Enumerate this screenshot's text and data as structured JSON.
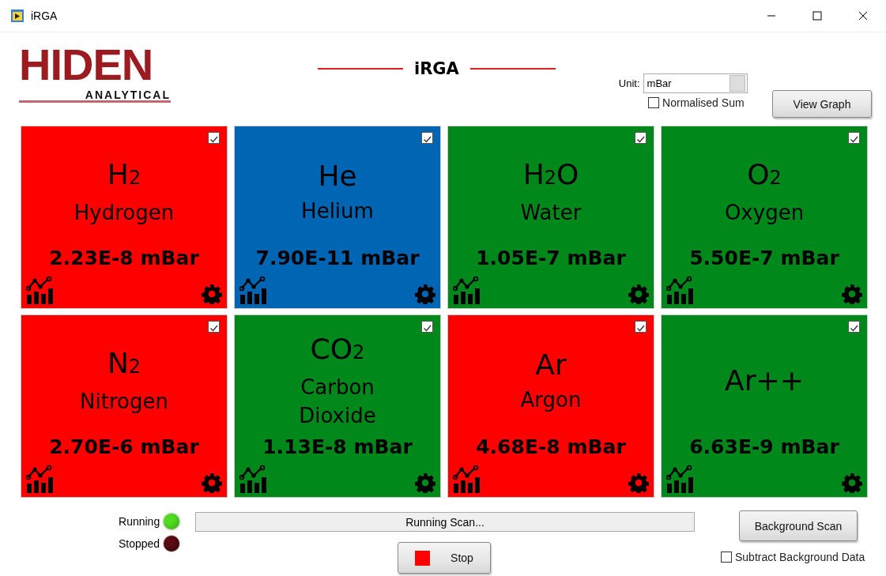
{
  "window": {
    "title": "iRGA"
  },
  "logo": {
    "name": "HIDEN",
    "tagline": "ANALYTICAL"
  },
  "header": {
    "title": "iRGA"
  },
  "unit": {
    "label": "Unit:",
    "value": "mBar"
  },
  "normalised_sum": {
    "label": "Normalised Sum",
    "checked": false
  },
  "view_graph_button": "View Graph",
  "gases": [
    {
      "formula": "H$_{2}$",
      "name": "Hydrogen",
      "reading": "2.23E-8 mBar",
      "color": "#ff0000",
      "checked": true
    },
    {
      "formula": "He",
      "name": "Helium",
      "reading": "7.90E-11 mBar",
      "color": "#0066b3",
      "checked": true
    },
    {
      "formula": "H$_{2}$O",
      "name": "Water",
      "reading": "1.05E-7 mBar",
      "color": "#00891a",
      "checked": true
    },
    {
      "formula": "O$_{2}$",
      "name": "Oxygen",
      "reading": "5.50E-7 mBar",
      "color": "#00891a",
      "checked": true
    },
    {
      "formula": "N$_{2}$",
      "name": "Nitrogen",
      "reading": "2.70E-6 mBar",
      "color": "#ff0000",
      "checked": true
    },
    {
      "formula": "CO$_{2}$",
      "name": "Carbon Dioxide",
      "reading": "1.13E-8 mBar",
      "color": "#00891a",
      "checked": true
    },
    {
      "formula": "Ar",
      "name": "Argon",
      "reading": "4.68E-8 mBar",
      "color": "#ff0000",
      "checked": true
    },
    {
      "formula": "Ar++",
      "reading": "6.63E-9 mBar",
      "color": "#00891a",
      "checked": true
    }
  ],
  "leds": [
    {
      "label": "Running",
      "on": true,
      "color": "#4fdc1e"
    },
    {
      "label": "Stopped",
      "on": false,
      "color": "#5c0b14"
    }
  ],
  "status": "Running Scan...",
  "stop_button": "Stop",
  "background_scan_button": "Background Scan",
  "subtract_background": {
    "label": "Subtract Background Data",
    "checked": false
  }
}
